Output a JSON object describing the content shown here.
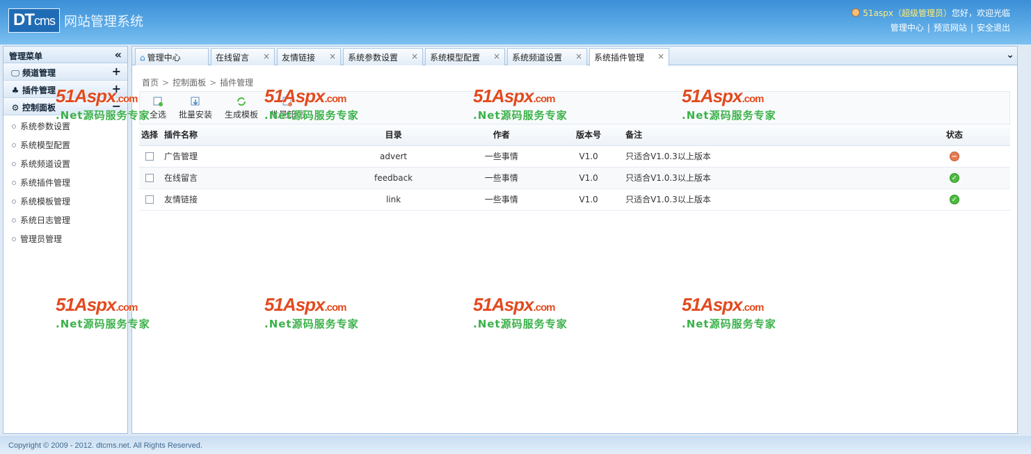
{
  "header": {
    "logo_mark_dt": "DT",
    "logo_mark_cms": "cms",
    "logo_subtitle": "网站管理系统",
    "user_name": "51aspx（超级管理员）",
    "user_greeting": "您好，欢迎光临",
    "links": [
      "管理中心",
      "预览网站",
      "安全退出"
    ]
  },
  "sidebar": {
    "title": "管理菜单",
    "collapse_glyph": "«",
    "groups": [
      {
        "label": "频道管理",
        "toggle": "+",
        "icon": "monitor-icon"
      },
      {
        "label": "插件管理",
        "toggle": "+",
        "icon": "puzzle-icon"
      },
      {
        "label": "控制面板",
        "toggle": "−",
        "icon": "gear-icon"
      }
    ],
    "items": [
      "系统参数设置",
      "系统模型配置",
      "系统频道设置",
      "系统插件管理",
      "系统模板管理",
      "系统日志管理",
      "管理员管理"
    ]
  },
  "tabs": [
    {
      "label": "管理中心",
      "closable": false,
      "icon": "home-icon"
    },
    {
      "label": "在线留言",
      "closable": true
    },
    {
      "label": "友情链接",
      "closable": true
    },
    {
      "label": "系统参数设置",
      "closable": true
    },
    {
      "label": "系统模型配置",
      "closable": true
    },
    {
      "label": "系统频道设置",
      "closable": true
    },
    {
      "label": "系统插件管理",
      "closable": true,
      "active": true
    }
  ],
  "tab_close_glyph": "×",
  "tab_more_glyph": "⌄",
  "breadcrumb": [
    "首页",
    "控制面板",
    "插件管理"
  ],
  "breadcrumb_sep": ">",
  "toolbar": {
    "select_all": "全选",
    "batch_install": "批量安装",
    "gen_template": "生成模板",
    "batch_uninstall": "批量卸载"
  },
  "table": {
    "headers": {
      "select": "选择",
      "name": "插件名称",
      "dir": "目录",
      "author": "作者",
      "version": "版本号",
      "remark": "备注",
      "status": "状态"
    },
    "rows": [
      {
        "name": "广告管理",
        "dir": "advert",
        "author": "一些事情",
        "version": "V1.0",
        "remark": "只适合V1.0.3以上版本",
        "status": "off"
      },
      {
        "name": "在线留言",
        "dir": "feedback",
        "author": "一些事情",
        "version": "V1.0",
        "remark": "只适合V1.0.3以上版本",
        "status": "on"
      },
      {
        "name": "友情链接",
        "dir": "link",
        "author": "一些事情",
        "version": "V1.0",
        "remark": "只适合V1.0.3以上版本",
        "status": "on"
      }
    ],
    "status_glyph_off": "−",
    "status_glyph_on": "✓"
  },
  "footer": "Copyright © 2009 - 2012. dtcms.net. All Rights Reserved.",
  "watermark": {
    "main": "51Aspx",
    "domain": ".com",
    "tagline": ".Net源码服务专家"
  },
  "colors": {
    "header": "#4a9ee0",
    "accent": "#3a86c8",
    "status_on": "#4cbb3e",
    "status_off": "#e87a52",
    "watermark_red": "#e24a1f",
    "watermark_green": "#3bb14a"
  }
}
